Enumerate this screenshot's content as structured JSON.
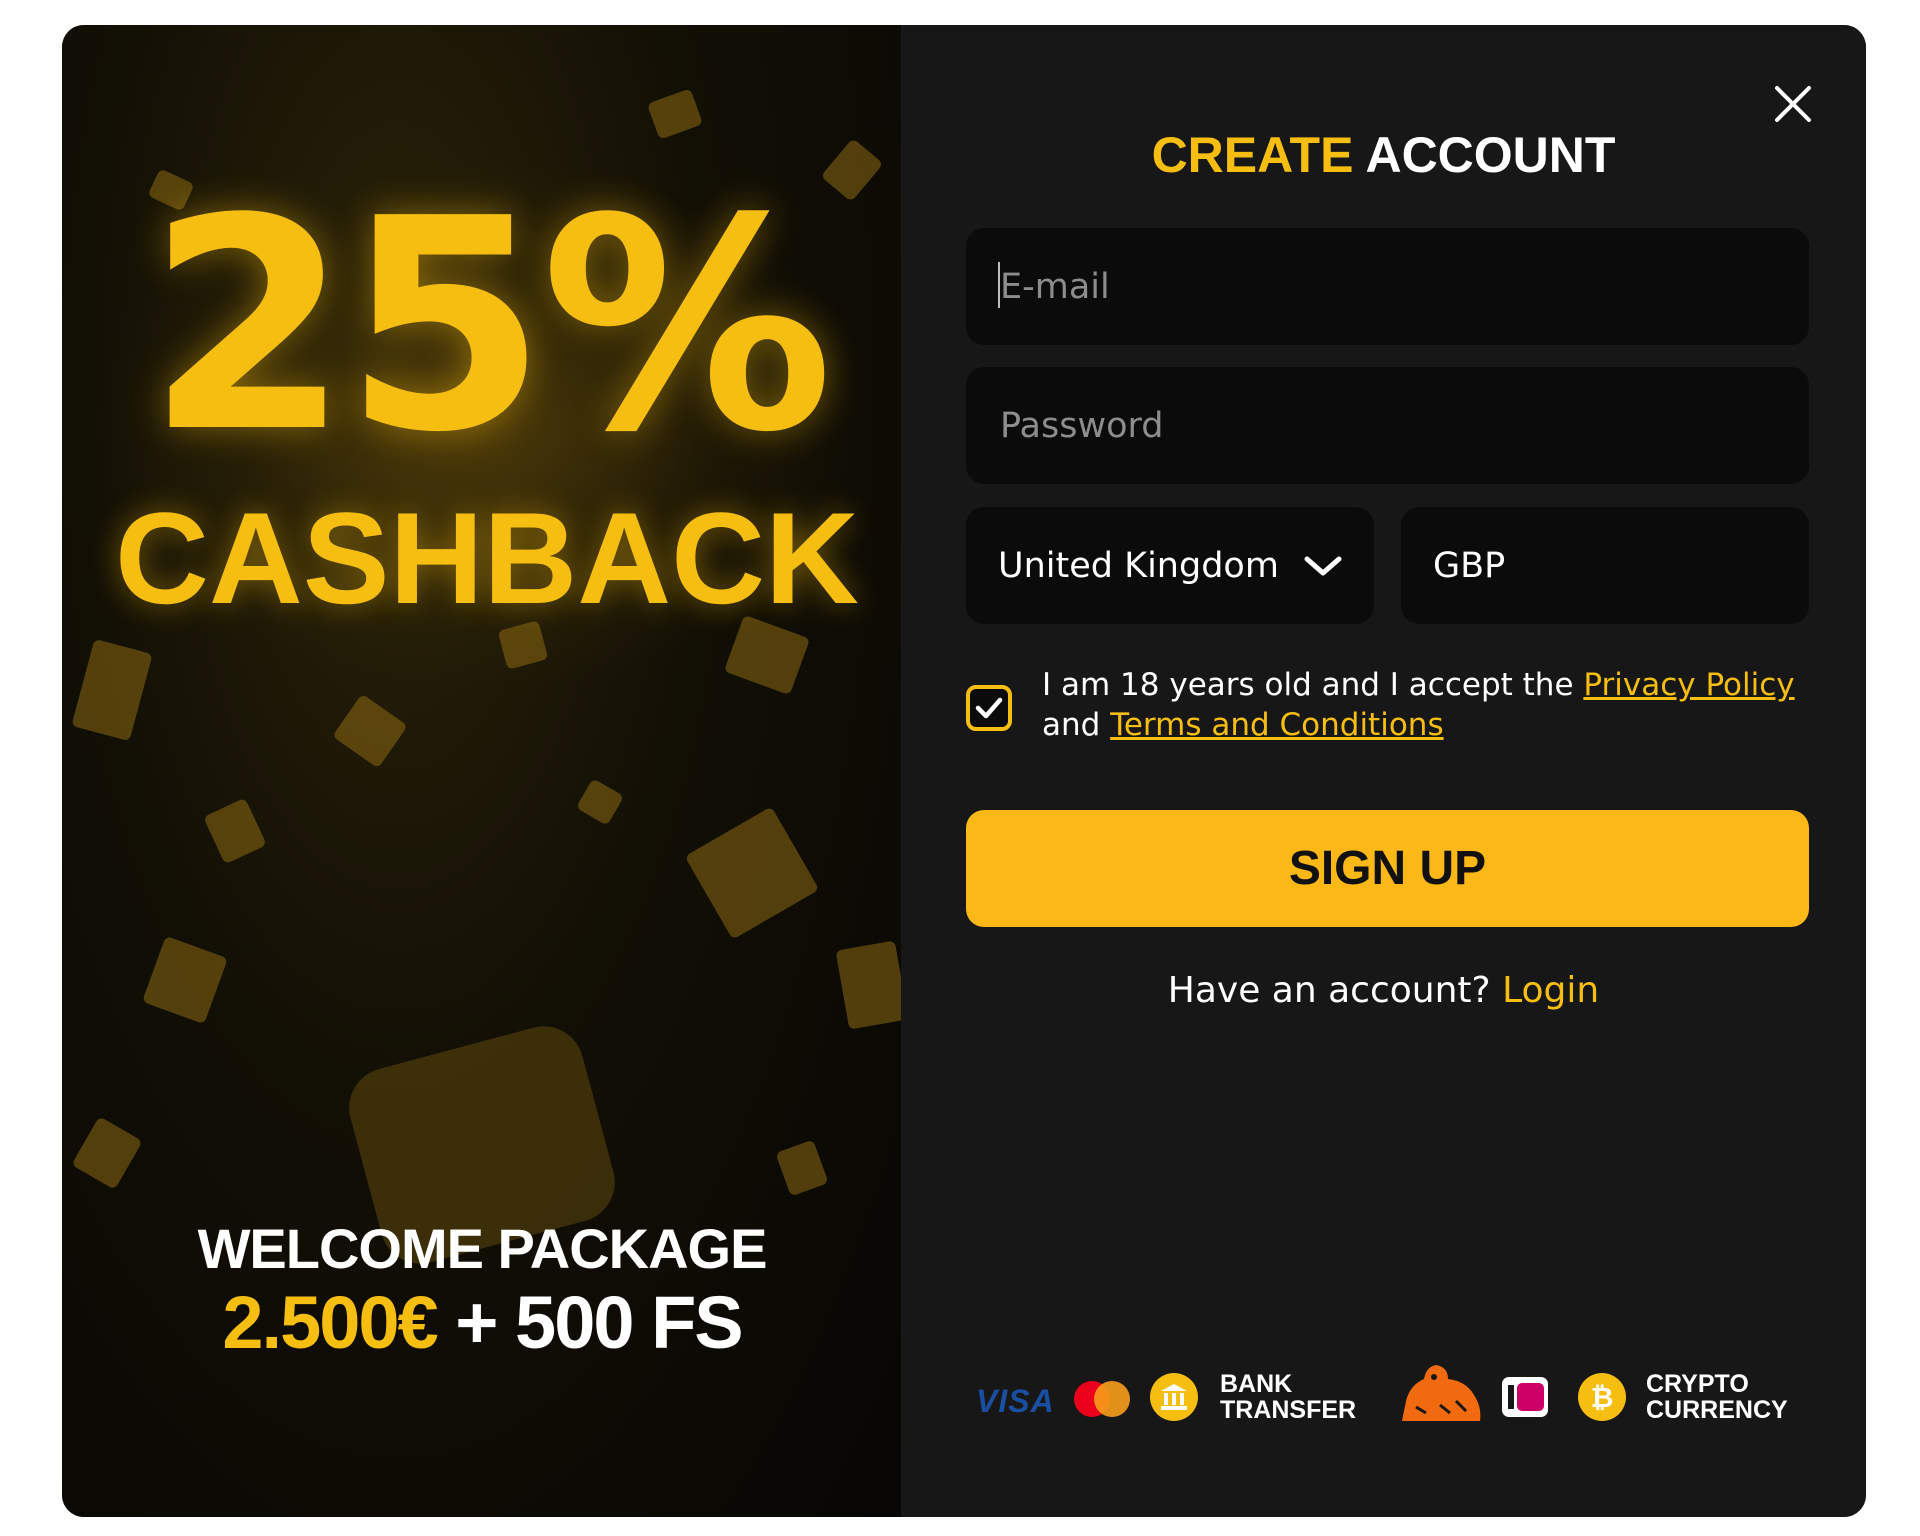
{
  "promo": {
    "percent": "25%",
    "cashback": "CASHBACK",
    "welcome": "WELCOME PACKAGE",
    "amount": "2.500€",
    "plus_fs": " + 500 FS"
  },
  "form": {
    "title_part1": "CREATE",
    "title_part2": " ACCOUNT",
    "email_placeholder": "E-mail",
    "password_placeholder": "Password",
    "country_value": "United Kingdom",
    "currency_value": "GBP",
    "consent_prefix": "I am 18 years old and I accept the ",
    "privacy_link": "Privacy Policy",
    "consent_and": " and ",
    "terms_link": "Terms and Conditions",
    "consent_checked": true,
    "signup_label": "SIGN UP",
    "have_account": "Have an account? ",
    "login_link": "Login"
  },
  "payments": {
    "visa": "VISA",
    "bank_line1": "BANK",
    "bank_line2": "TRANSFER",
    "crypto_line1": "CRYPTO",
    "crypto_line2": "CURRENCY",
    "icons": [
      "visa-logo",
      "mastercard-logo",
      "bank-icon",
      "ing-lion-logo",
      "ideal-logo",
      "bitcoin-icon"
    ]
  },
  "colors": {
    "accent": "#f7be12",
    "button": "#fbb816",
    "panel": "#171717",
    "field": "#0b0b0b"
  }
}
